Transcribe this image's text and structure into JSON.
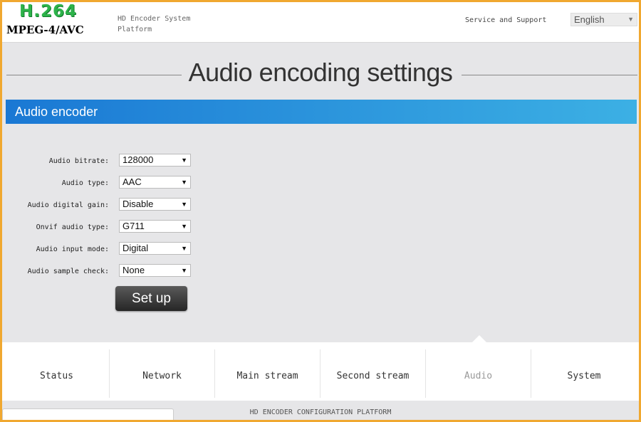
{
  "header": {
    "logo_top": "H.264",
    "logo_bottom": "MPEG-4/AVC",
    "platform_text": "HD Encoder System Platform",
    "support_link": "Service and Support",
    "language": "English"
  },
  "page_title": "Audio encoding settings",
  "section_title": "Audio encoder",
  "form": {
    "fields": [
      {
        "label": "Audio bitrate:",
        "value": "128000"
      },
      {
        "label": "Audio type:",
        "value": "AAC"
      },
      {
        "label": "Audio digital gain:",
        "value": "Disable"
      },
      {
        "label": "Onvif audio type:",
        "value": "G711"
      },
      {
        "label": "Audio input mode:",
        "value": "Digital"
      },
      {
        "label": "Audio sample check:",
        "value": "None"
      }
    ],
    "submit_label": "Set up"
  },
  "nav": {
    "tabs": [
      {
        "label": "Status"
      },
      {
        "label": "Network"
      },
      {
        "label": "Main stream"
      },
      {
        "label": "Second stream"
      },
      {
        "label": "Audio"
      },
      {
        "label": "System"
      }
    ],
    "active_tab": "Audio"
  },
  "footer": "HD ENCODER CONFIGURATION PLATFORM",
  "colors": {
    "frame": "#f0a830",
    "section_gradient_start": "#1a78d4",
    "section_gradient_end": "#3cb0e4",
    "logo_green": "#2db34a"
  }
}
